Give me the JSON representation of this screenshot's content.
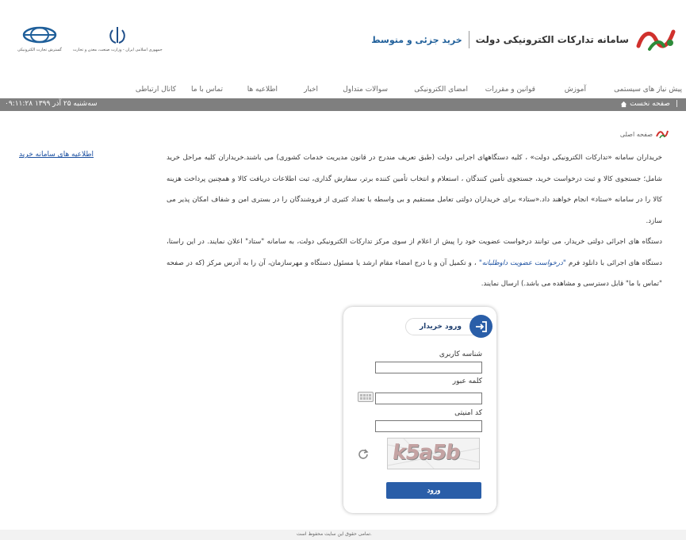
{
  "header": {
    "brand_title": "سامانه تدارکات الکترونیکی دولت",
    "brand_subtitle": "خرید جزئی و متوسط",
    "brand_logo_icon": "setad-logo-icon",
    "gov_logo1_caption": "جمهوری اسلامی ایران - وزارت صنعت، معدن و تجارت",
    "gov_logo2_caption": "گسترش تجارت الکترونیکی"
  },
  "menu": {
    "items": [
      "پیش نیاز های سیستمی",
      "آموزش",
      "قوانین و مقررات",
      "امضای الکترونیکی",
      "سوالات متداول",
      "اخبار",
      "اطلاعیه ها",
      "تماس با ما",
      "کانال ارتباطی"
    ]
  },
  "statusbar": {
    "home_label": "صفحه نخست",
    "datetime": "سه‌شنبه ۲۵ آذر ۱۳۹۹ ۰۹:۱۱:۲۸"
  },
  "breadcrumb": {
    "label": "صفحه اصلی"
  },
  "sidebar": {
    "link": "اطلاعیه های سامانه خرید"
  },
  "content": {
    "p1": "خریداران سامانه «تدارکات الکترونیکی دولت» ، کلیه دستگاههای اجرایی دولت (طبق تعریف مندرج در قانون مدیریت خدمات کشوری) می باشند.خریداران کلیه مراحل خرید شامل؛ جستجوی کالا و ثبت درخواست خرید، جستجوی تأمین کنندگان ، استعلام و انتخاب تأمین کننده برتر، سفارش گذاری، ثبت اطلاعات دریافت کالا و همچنین پرداخت هزینه کالا را در سامانه «ستاد» انجام خواهند داد.«ستاد» برای خریداران دولتی تعامل مستقیم و بی واسطه با تعداد کثیری از فروشندگان را در بستری امن و شفاف امکان پذیر می سازد.",
    "p2_before": "دستگاه های اجرائی دولتی خریدار، می توانند درخواست عضویت خود را پیش از اعلام از سوی مرکز تدارکات الکترونیکی دولت، به سامانه \"ستاد\" اعلان نمایند. در این راستا، دستگاه های اجرائی با دانلود فرم",
    "p2_link": "\"درخواست عضویت داوطلبانه\"",
    "p2_after": "، و تکمیل آن و با درج امضاء مقام ارشد یا مسئول دستگاه و مهرسازمان، آن را به آدرس مرکز (که در صفحه \"تماس با ما\" قابل دسترسی و مشاهده می باشد.) ارسال نمایند."
  },
  "login": {
    "title": "ورود خریدار",
    "username_label": "شناسه کاربری",
    "password_label": "کلمه عبور",
    "captcha_label": "کد امنیتی",
    "username_value": "",
    "password_value": "",
    "captcha_value": "",
    "captcha_text": "k5a5b",
    "submit_label": "ورود"
  },
  "footer": {
    "text": "تمامی حقوق این سایت محفوظ است."
  },
  "colors": {
    "accent_blue": "#2a5ea8",
    "brand_green": "#2e8b3a",
    "brand_red": "#d0312d",
    "statusbar_gray": "#7f7f7f"
  }
}
